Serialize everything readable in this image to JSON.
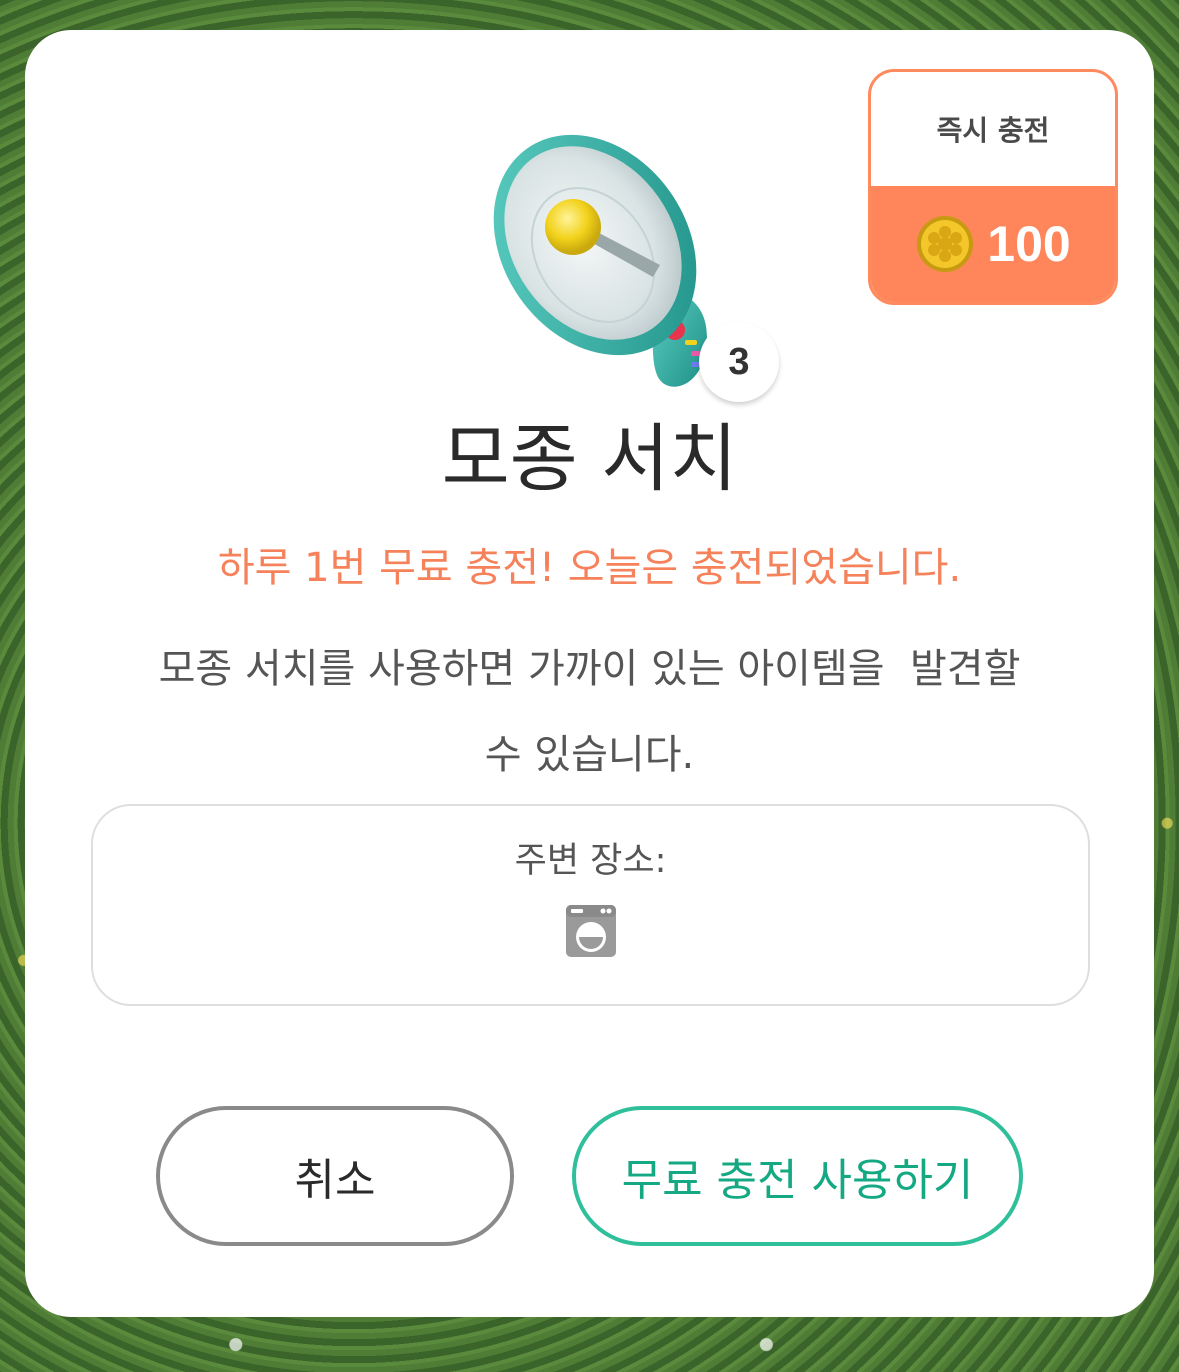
{
  "colors": {
    "accent": "#f5825a",
    "confirm": "#15a983",
    "instant_charge_bg": "#ff855a"
  },
  "item": {
    "icon": "megaphone-icon",
    "count": "3",
    "title": "모종 서치"
  },
  "instant_charge": {
    "label": "즉시 충전",
    "coin_icon": "gold-coin-icon",
    "price": "100"
  },
  "notice": "하루 1번 무료 충전! 오늘은 충전되었습니다.",
  "description": "모종 서치를 사용하면 가까이 있는 아이템을  발견할\n수 있습니다.",
  "nearby": {
    "label": "주변 장소:",
    "place_icon": "washing-machine-icon"
  },
  "buttons": {
    "cancel": "취소",
    "confirm": "무료 충전 사용하기"
  }
}
